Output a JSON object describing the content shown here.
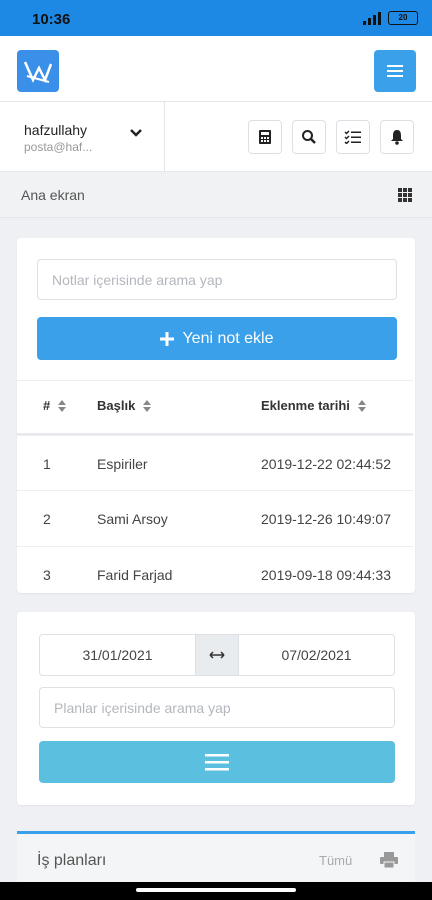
{
  "status_bar": {
    "time": "10:36",
    "battery": "20"
  },
  "user": {
    "name": "hafzullahy",
    "email": "posta@haf..."
  },
  "breadcrumb": {
    "label": "Ana ekran"
  },
  "notes": {
    "search_placeholder": "Notlar içerisinde arama yap",
    "add_button": "Yeni not ekle",
    "columns": [
      "#",
      "Başlık",
      "Eklenme tarihi"
    ],
    "rows": [
      {
        "no": "1",
        "title": "Espiriler",
        "date": "2019-12-22 02:44:52"
      },
      {
        "no": "2",
        "title": "Sami Arsoy",
        "date": "2019-12-26 10:49:07"
      },
      {
        "no": "3",
        "title": "Farid Farjad",
        "date": "2019-09-18 09:44:33"
      }
    ]
  },
  "plans": {
    "date_from": "31/01/2021",
    "date_to": "07/02/2021",
    "search_placeholder": "Planlar içerisinde arama yap"
  },
  "work_plans": {
    "title": "İş planları",
    "all_label": "Tümü"
  },
  "colors": {
    "primary": "#3aa0ea",
    "status_bar": "#1e88e5",
    "plan_button": "#5bbfe0"
  }
}
